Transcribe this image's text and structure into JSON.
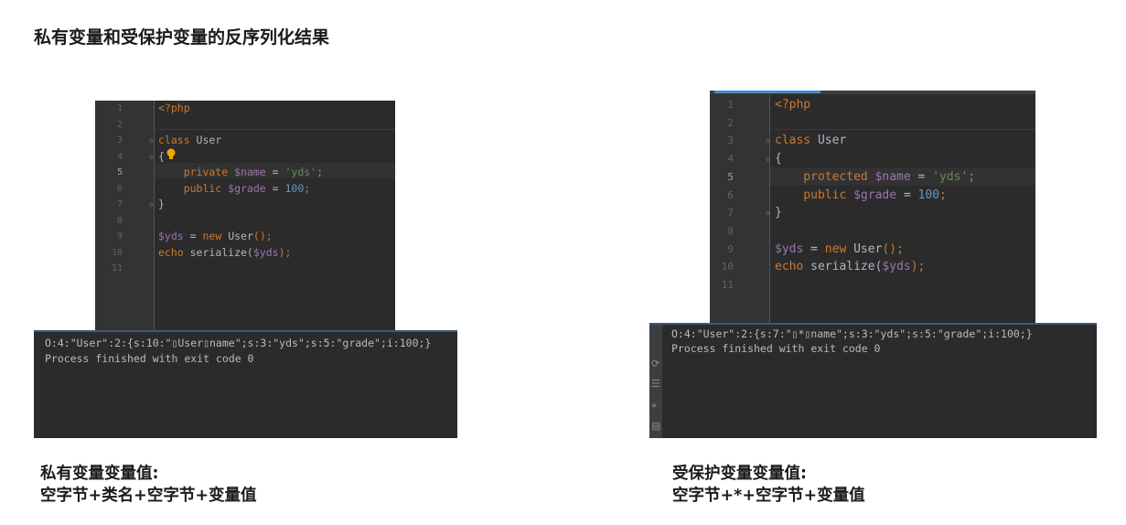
{
  "page_title": "私有变量和受保护变量的反序列化结果",
  "left_editor": {
    "line_numbers": [
      "1",
      "2",
      "3",
      "4",
      "5",
      "6",
      "7",
      "8",
      "9",
      "10",
      "11"
    ],
    "active_line": "5",
    "lines": [
      [
        {
          "t": "<?php",
          "c": "tag"
        }
      ],
      [],
      [
        {
          "t": "class ",
          "c": "kw"
        },
        {
          "t": "User",
          "c": "plain"
        }
      ],
      [
        {
          "t": "{",
          "c": "plain"
        }
      ],
      [
        {
          "t": "    private ",
          "c": "kw"
        },
        {
          "t": "$name",
          "c": "var"
        },
        {
          "t": " = ",
          "c": "plain"
        },
        {
          "t": "'yds'",
          "c": "str"
        },
        {
          "t": ";",
          "c": "kw"
        }
      ],
      [
        {
          "t": "    public ",
          "c": "kw"
        },
        {
          "t": "$grade",
          "c": "var"
        },
        {
          "t": " = ",
          "c": "plain"
        },
        {
          "t": "100",
          "c": "num"
        },
        {
          "t": ";",
          "c": "kw"
        }
      ],
      [
        {
          "t": "}",
          "c": "plain"
        }
      ],
      [],
      [
        {
          "t": "$yds",
          "c": "var"
        },
        {
          "t": " = ",
          "c": "plain"
        },
        {
          "t": "new ",
          "c": "kw"
        },
        {
          "t": "User",
          "c": "plain"
        },
        {
          "t": "();",
          "c": "kw"
        }
      ],
      [
        {
          "t": "echo ",
          "c": "kw"
        },
        {
          "t": "serialize(",
          "c": "plain"
        },
        {
          "t": "$yds",
          "c": "var"
        },
        {
          "t": ");",
          "c": "kw"
        }
      ],
      []
    ]
  },
  "left_terminal": {
    "output_line": "O:4:\"User\":2:{s:10:\"▯User▯name\";s:3:\"yds\";s:5:\"grade\";i:100;}",
    "exit_line": "Process finished with exit code 0"
  },
  "left_caption": {
    "line1": "私有变量变量值:",
    "line2": "空字节+类名+空字节+变量值"
  },
  "right_editor": {
    "line_numbers": [
      "1",
      "2",
      "3",
      "4",
      "5",
      "6",
      "7",
      "8",
      "9",
      "10",
      "11"
    ],
    "active_line": "5",
    "lines": [
      [
        {
          "t": "<?php",
          "c": "tag"
        }
      ],
      [],
      [
        {
          "t": "class ",
          "c": "kw"
        },
        {
          "t": "User",
          "c": "plain"
        }
      ],
      [
        {
          "t": "{",
          "c": "plain"
        }
      ],
      [
        {
          "t": "    protected ",
          "c": "kw"
        },
        {
          "t": "$name",
          "c": "var"
        },
        {
          "t": " = ",
          "c": "plain"
        },
        {
          "t": "'yds'",
          "c": "str"
        },
        {
          "t": ";",
          "c": "kw"
        }
      ],
      [
        {
          "t": "    public ",
          "c": "kw"
        },
        {
          "t": "$grade",
          "c": "var"
        },
        {
          "t": " = ",
          "c": "plain"
        },
        {
          "t": "100",
          "c": "num"
        },
        {
          "t": ";",
          "c": "kw"
        }
      ],
      [
        {
          "t": "}",
          "c": "plain"
        }
      ],
      [],
      [
        {
          "t": "$yds",
          "c": "var"
        },
        {
          "t": " = ",
          "c": "plain"
        },
        {
          "t": "new ",
          "c": "kw"
        },
        {
          "t": "User",
          "c": "plain"
        },
        {
          "t": "();",
          "c": "kw"
        }
      ],
      [
        {
          "t": "echo ",
          "c": "kw"
        },
        {
          "t": "serialize(",
          "c": "plain"
        },
        {
          "t": "$yds",
          "c": "var"
        },
        {
          "t": ");",
          "c": "kw"
        }
      ],
      []
    ]
  },
  "right_terminal": {
    "output_line": "O:4:\"User\":2:{s:7:\"▯*▯name\";s:3:\"yds\";s:5:\"grade\";i:100;}",
    "exit_line": "Process finished with exit code 0"
  },
  "right_caption": {
    "line1": "受保护变量变量值:",
    "line2": "空字节+*+空字节+变量值"
  },
  "colors": {
    "keyword": "#cc7832",
    "variable": "#9876aa",
    "string": "#6a8759",
    "number": "#6897bb",
    "plain": "#a9b7c6",
    "editor_bg": "#2b2b2b"
  },
  "icons": {
    "left_editor_hint": "lightbulb-icon",
    "fold_markers": "fold-arrow-icon"
  }
}
